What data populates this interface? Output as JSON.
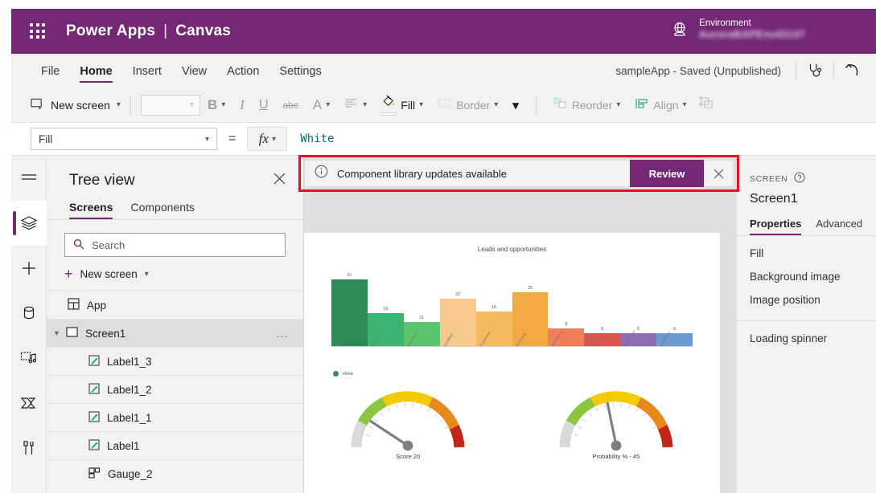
{
  "header": {
    "waffle_icon": "waffle-grid-icon",
    "brand": "Power Apps",
    "separator": "|",
    "product": "Canvas",
    "environment_label": "Environment",
    "environment_name": "AuroraBAPEnv43137",
    "environment_icon": "globe-environment-icon",
    "brand_color": "#742774"
  },
  "menubar": {
    "items": [
      {
        "label": "File",
        "active": false
      },
      {
        "label": "Home",
        "active": true
      },
      {
        "label": "Insert",
        "active": false
      },
      {
        "label": "View",
        "active": false
      },
      {
        "label": "Action",
        "active": false
      },
      {
        "label": "Settings",
        "active": false
      }
    ],
    "app_status": "sampleApp - Saved (Unpublished)",
    "checker_icon": "stethoscope-app-checker-icon",
    "undo_icon": "undo-arrow-icon"
  },
  "ribbon": {
    "new_screen": "New screen",
    "font_value": "",
    "bold": "B",
    "italic": "I",
    "underline": "U",
    "strikethrough": "abc",
    "font_color": "A",
    "align_icon": "text-align-icon",
    "fill": "Fill",
    "border": "Border",
    "more_icon": "chevron-down-icon",
    "reorder": "Reorder",
    "align": "Align",
    "group_icon": "group-objects-icon"
  },
  "formula_bar": {
    "property": "Fill",
    "equals": "=",
    "fx": "fx",
    "value": "White"
  },
  "notification": {
    "info_icon": "info-circle-icon",
    "message": "Component library updates available",
    "review_label": "Review",
    "close_icon": "close-icon",
    "highlight_color": "#e81123"
  },
  "rail": {
    "items": [
      {
        "name": "menu-hamburger-icon",
        "active": false
      },
      {
        "name": "tree-view-layers-icon",
        "active": true
      },
      {
        "name": "insert-plus-icon",
        "active": false
      },
      {
        "name": "data-cylinder-icon",
        "active": false
      },
      {
        "name": "media-icon",
        "active": false
      },
      {
        "name": "power-automate-flow-icon",
        "active": false
      },
      {
        "name": "variables-tools-icon",
        "active": false
      }
    ]
  },
  "tree_view": {
    "title": "Tree view",
    "close_icon": "close-icon",
    "tabs": [
      {
        "label": "Screens",
        "active": true
      },
      {
        "label": "Components",
        "active": false
      }
    ],
    "search_placeholder": "Search",
    "search_icon": "search-icon",
    "new_screen": "New screen",
    "items": [
      {
        "label": "App",
        "icon": "app-icon",
        "level": 0,
        "selected": false,
        "expander": "",
        "menu": ""
      },
      {
        "label": "Screen1",
        "icon": "screen-icon",
        "level": 0,
        "selected": true,
        "expander": "chevron-down-icon",
        "menu": "..."
      },
      {
        "label": "Label1_3",
        "icon": "label-icon",
        "level": 1,
        "selected": false,
        "expander": "",
        "menu": ""
      },
      {
        "label": "Label1_2",
        "icon": "label-icon",
        "level": 1,
        "selected": false,
        "expander": "",
        "menu": ""
      },
      {
        "label": "Label1_1",
        "icon": "label-icon",
        "level": 1,
        "selected": false,
        "expander": "",
        "menu": ""
      },
      {
        "label": "Label1",
        "icon": "label-icon",
        "level": 1,
        "selected": false,
        "expander": "",
        "menu": ""
      },
      {
        "label": "Gauge_2",
        "icon": "gauge-component-icon",
        "level": 1,
        "selected": false,
        "expander": "",
        "menu": ""
      }
    ]
  },
  "properties_panel": {
    "kind": "SCREEN",
    "help_icon": "help-circle-icon",
    "name": "Screen1",
    "tabs": [
      {
        "label": "Properties",
        "active": true
      },
      {
        "label": "Advanced",
        "active": false
      }
    ],
    "items": [
      "Fill",
      "Background image",
      "Image position"
    ],
    "items2": [
      "Loading spinner"
    ]
  },
  "chart_data": [
    {
      "type": "bar",
      "title": "Leads and opportunities",
      "categories": [
        "Cold",
        "Open",
        "Interested",
        "Qualified",
        "Contacted",
        "Nurturing",
        "Won/Not In",
        "Visited",
        "Unqualified",
        "Lost/Other"
      ],
      "values": [
        31,
        15,
        11,
        22,
        16,
        25,
        8,
        6,
        6,
        6
      ],
      "colors": [
        "#2e8b57",
        "#3cb371",
        "#5cc46e",
        "#f7c98a",
        "#f7b95e",
        "#f2a93f",
        "#ef7f5a",
        "#d9534f",
        "#8e6bb5",
        "#6b9bd2"
      ],
      "legend": [
        {
          "label": "Area",
          "color": "#2e8b57"
        }
      ],
      "legend_position": "bottom-left",
      "xlabel": "",
      "ylabel": "",
      "ylim": [
        0,
        31
      ],
      "grid": false
    },
    {
      "type": "gauge",
      "title": "Score",
      "caption": "Score    20",
      "value": 20,
      "min": 0,
      "max": 100,
      "bands": [
        {
          "color": "#d9d9d9",
          "to": 12
        },
        {
          "color": "#8cc63e",
          "to": 30
        },
        {
          "color": "#f2cb05",
          "to": 58
        },
        {
          "color": "#e8881a",
          "to": 84
        },
        {
          "color": "#c1261b",
          "to": 100
        }
      ]
    },
    {
      "type": "gauge",
      "title": "Probability %",
      "caption": "Probability % -  45",
      "value": 45,
      "min": 0,
      "max": 100,
      "bands": [
        {
          "color": "#d9d9d9",
          "to": 12
        },
        {
          "color": "#8cc63e",
          "to": 30
        },
        {
          "color": "#f2cb05",
          "to": 58
        },
        {
          "color": "#e8881a",
          "to": 84
        },
        {
          "color": "#c1261b",
          "to": 100
        }
      ]
    }
  ]
}
